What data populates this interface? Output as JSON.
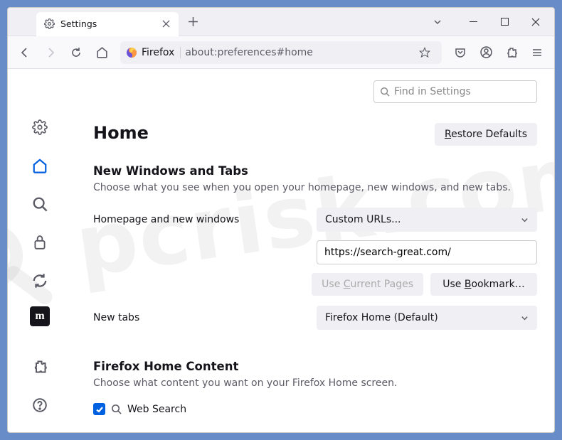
{
  "window": {
    "tab_title": "Settings"
  },
  "navbar": {
    "identity": "Firefox",
    "url": "about:preferences#home"
  },
  "search": {
    "placeholder": "Find in Settings"
  },
  "page": {
    "title": "Home",
    "restore_defaults": "Restore Defaults",
    "restore_key": "R",
    "section1_title": "New Windows and Tabs",
    "section1_desc": "Choose what you see when you open your homepage, new windows, and new tabs.",
    "homepage_label": "Homepage and new windows",
    "homepage_select": "Custom URLs...",
    "homepage_url": "https://search-great.com/",
    "use_current_pre": "Use ",
    "use_current_key": "C",
    "use_current_post": "urrent Pages",
    "use_bookmark_pre": "Use ",
    "use_bookmark_key": "B",
    "use_bookmark_post": "ookmark…",
    "newtabs_label": "New tabs",
    "newtabs_select": "Firefox Home (Default)",
    "section2_title": "Firefox Home Content",
    "section2_desc": "Choose what content you want on your Firefox Home screen.",
    "websearch_label": "Web Search"
  }
}
